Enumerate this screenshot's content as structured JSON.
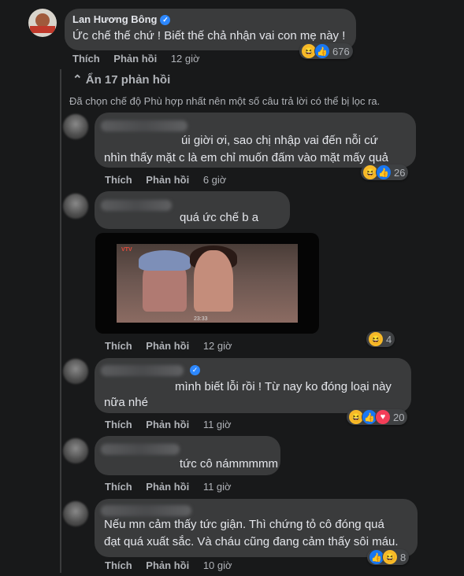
{
  "top_comment": {
    "author": "Lan Hương Bông",
    "text": "Ức chế thế chứ ! Biết thế chả nhận vai con mẹ này !",
    "like_label": "Thích",
    "reply_label": "Phản hồi",
    "time": "12 giờ",
    "reaction_count": "676",
    "reactions": [
      "haha",
      "like"
    ]
  },
  "hide_replies_label": "Ẩn 17 phản hồi",
  "filter_note": "Đã chọn chế độ Phù hợp nhất nên một số câu trả lời có thể bị lọc ra.",
  "replies": [
    {
      "lines": [
        "úi giời ơi, sao chị nhập vai đến nỗi cứ",
        "nhìn thấy mặt c là em chỉ muốn đấm vào mặt mấy quả"
      ],
      "like_label": "Thích",
      "reply_label": "Phản hồi",
      "time": "6 giờ",
      "reaction_count": "26"
    },
    {
      "lines": [
        "quá ức chế b a"
      ],
      "like_label": "Thích",
      "reply_label": "Phản hồi",
      "time": "12 giờ",
      "reaction_count": "4",
      "video": {
        "channel_logo": "VTV",
        "timestamp": "23:33"
      }
    },
    {
      "lines": [
        "mình biết lỗi rồi ! Từ nay ko đóng loại này",
        "nữa nhé"
      ],
      "like_label": "Thích",
      "reply_label": "Phản hồi",
      "time": "11 giờ",
      "reaction_count": "20"
    },
    {
      "lines": [
        "tức cô námmmmm"
      ],
      "like_label": "Thích",
      "reply_label": "Phản hồi",
      "time": "11 giờ"
    },
    {
      "lines": [
        "Nếu mn cảm thấy tức giận. Thì chứng tỏ cô đóng quá",
        "đạt quá xuất sắc. Và cháu cũng đang cảm thấy sôi máu."
      ],
      "like_label": "Thích",
      "reply_label": "Phản hồi",
      "time": "10 giờ",
      "reaction_count": "8"
    }
  ],
  "colors": {
    "background": "#18191a",
    "bubble": "#3a3b3c",
    "text": "#e4e6eb",
    "secondary": "#b0b3b8",
    "like_blue": "#1877f2",
    "haha_yellow": "#f7b928",
    "love_red": "#f33e58"
  }
}
